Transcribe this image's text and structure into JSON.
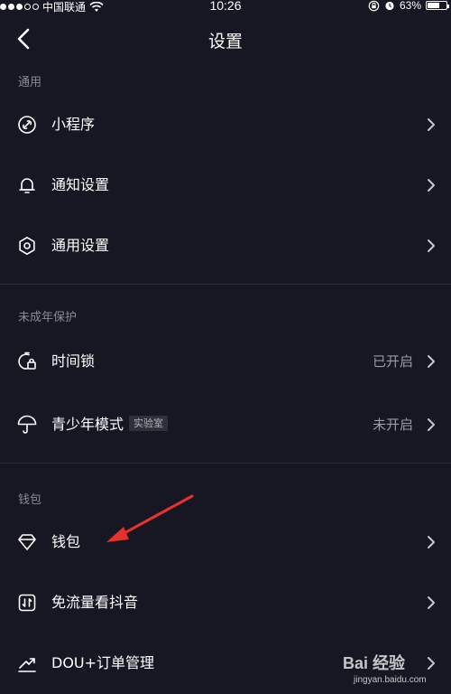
{
  "status_bar": {
    "carrier": "中国联通",
    "time": "10:26",
    "battery_percent": "63%",
    "battery_level": 0.63
  },
  "nav": {
    "title": "设置"
  },
  "sections": {
    "general": {
      "title": "通用",
      "items": [
        {
          "label": "小程序",
          "icon": "link-icon"
        },
        {
          "label": "通知设置",
          "icon": "bell-icon"
        },
        {
          "label": "通用设置",
          "icon": "gear-icon"
        }
      ]
    },
    "minor": {
      "title": "未成年保护",
      "items": [
        {
          "label": "时间锁",
          "value": "已开启",
          "icon": "timer-lock-icon"
        },
        {
          "label": "青少年模式",
          "badge": "实验室",
          "value": "未开启",
          "icon": "umbrella-icon"
        }
      ]
    },
    "wallet": {
      "title": "钱包",
      "items": [
        {
          "label": "钱包",
          "icon": "diamond-icon"
        },
        {
          "label": "免流量看抖音",
          "icon": "data-card-icon"
        },
        {
          "label": "DOU+订单管理",
          "icon": "trend-icon"
        }
      ]
    }
  },
  "annotation": {
    "arrow_color": "#e8312a"
  },
  "watermark": {
    "main": "Bai 经验",
    "sub": "jingyan.baidu.com"
  }
}
